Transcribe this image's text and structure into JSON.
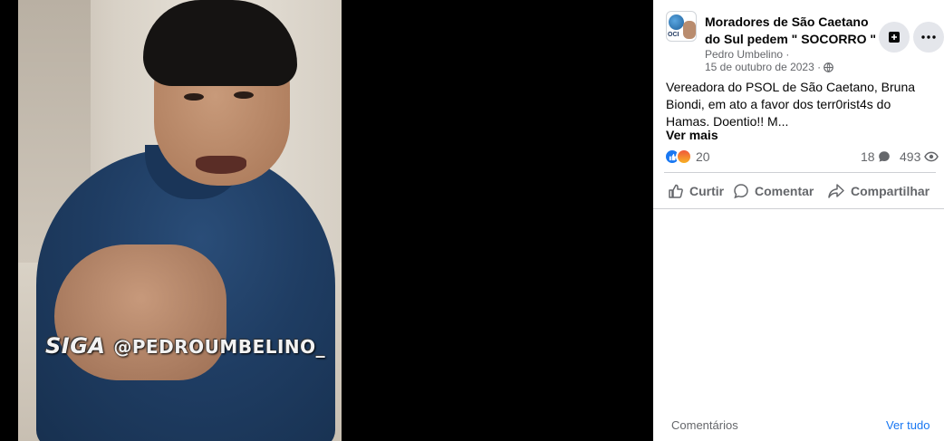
{
  "video": {
    "watermark_prefix": "SIGA",
    "watermark_handle": "@PEDROUMBELINO_"
  },
  "post": {
    "group_name": "Moradores de São Caetano do Sul pedem \" SOCORRO \"",
    "avatar_text": "OCI",
    "author": "Pedro Umbelino ·",
    "date": "15 de outubro de 2023 ·",
    "text": "Vereadora do PSOL de São Caetano, Bruna Biondi, em ato a favor dos terr0rist4s do Hamas. Doentio!! M...",
    "see_more": "Ver mais",
    "reaction_count": "20",
    "comment_count": "18",
    "view_count": "493",
    "actions": {
      "like": "Curtir",
      "comment": "Comentar",
      "share": "Compartilhar"
    }
  },
  "footer": {
    "comments_label": "Comentários",
    "see_all": "Ver tudo"
  },
  "colors": {
    "accent": "#1877f2",
    "secondary_text": "#65676b",
    "button_bg": "#e4e6eb"
  }
}
